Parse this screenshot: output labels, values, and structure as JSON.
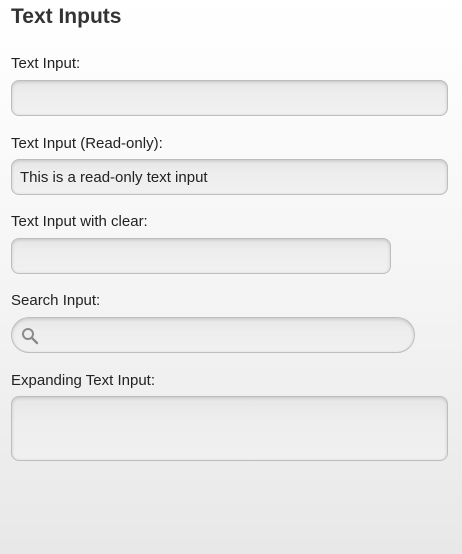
{
  "page": {
    "title": "Text Inputs"
  },
  "fields": {
    "text_input": {
      "label": "Text Input:",
      "value": "",
      "placeholder": ""
    },
    "readonly_input": {
      "label": "Text Input (Read-only):",
      "value": "This is a read-only text input"
    },
    "clear_input": {
      "label": "Text Input with clear:",
      "value": "",
      "placeholder": ""
    },
    "search_input": {
      "label": "Search Input:",
      "value": "",
      "placeholder": "",
      "icon": "search-icon"
    },
    "expanding_input": {
      "label": "Expanding Text Input:",
      "value": "",
      "placeholder": ""
    }
  }
}
